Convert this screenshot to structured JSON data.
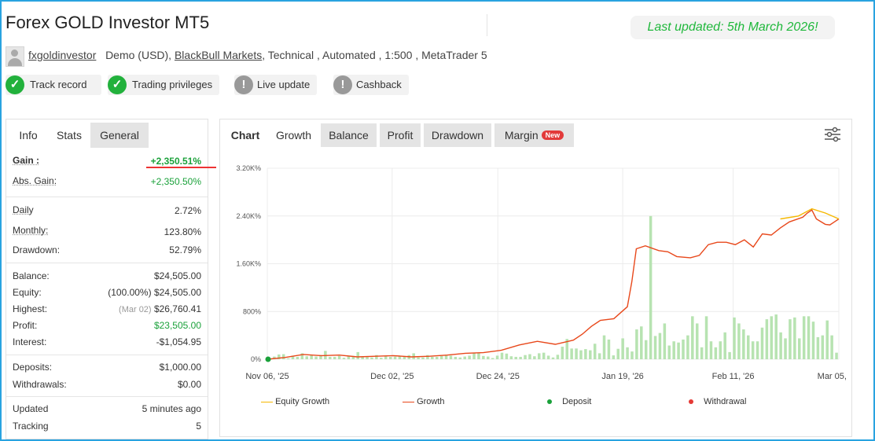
{
  "header": {
    "title": "Forex GOLD Investor MT5",
    "last_updated": "Last updated: 5th March 2026!"
  },
  "account": {
    "username": "fxgoldinvestor",
    "account_type": "Demo (USD),",
    "broker": "BlackBull Markets",
    "details": ", Technical , Automated , 1:500 , MetaTrader 5"
  },
  "badges": [
    {
      "label": "Track record",
      "icon": "check-icon"
    },
    {
      "label": "Trading privileges",
      "icon": "check-icon"
    },
    {
      "label": "Live update",
      "icon": "exclamation-icon"
    },
    {
      "label": "Cashback",
      "icon": "exclamation-icon"
    }
  ],
  "left_tabs": [
    "Info",
    "Stats",
    "General"
  ],
  "stats": {
    "gain": {
      "label": "Gain :",
      "value": "+2,350.51%"
    },
    "abs_gain": {
      "label": "Abs. Gain:",
      "value": "+2,350.50%"
    },
    "daily": {
      "label": "Daily",
      "value": "2.72%"
    },
    "monthly": {
      "label": "Monthly:",
      "value": "123.80%"
    },
    "drawdown": {
      "label": "Drawdown:",
      "value": "52.79%"
    },
    "balance": {
      "label": "Balance:",
      "value": "$24,505.00"
    },
    "equity": {
      "label": "Equity:",
      "pct": "(100.00%)",
      "value": "$24,505.00"
    },
    "highest": {
      "label": "Highest:",
      "date": "(Mar 02)",
      "value": "$26,760.41"
    },
    "profit": {
      "label": "Profit:",
      "value": "$23,505.00"
    },
    "interest": {
      "label": "Interest:",
      "value": "-$1,054.95"
    },
    "deposits": {
      "label": "Deposits:",
      "value": "$1,000.00"
    },
    "withdrawals": {
      "label": "Withdrawals:",
      "value": "$0.00"
    },
    "updated": {
      "label": "Updated",
      "value": "5 minutes ago"
    },
    "tracking": {
      "label": "Tracking",
      "value": "5"
    }
  },
  "chart_tabs": {
    "chart": "Chart",
    "growth": "Growth",
    "balance": "Balance",
    "profit": "Profit",
    "drawdown": "Drawdown",
    "margin": "Margin",
    "new_badge": "New"
  },
  "colors": {
    "accent_green": "#1fb83b",
    "frame_blue": "#29a3e0",
    "equity_line": "#f5b800",
    "growth_line": "#e8481b",
    "deposit": "#1aa13a",
    "withdrawal": "#e53935",
    "bars": "#b7e3b1"
  },
  "chart_data": {
    "type": "line",
    "y_ticks": [
      "0%",
      "800%",
      "1.60K%",
      "2.40K%",
      "3.20K%"
    ],
    "ylim": [
      0,
      3200
    ],
    "x_ticks": [
      "Nov 06, '25",
      "Dec 02, '25",
      "Dec 24, '25",
      "Jan 19, '26",
      "Feb 11, '26",
      "Mar 05, '26"
    ],
    "x_tick_days": [
      0,
      26,
      48,
      74,
      97,
      119
    ],
    "xlim": [
      0,
      119
    ],
    "grid": true,
    "legend_position": "bottom",
    "series": [
      {
        "name": "Equity Growth",
        "points": [
          [
            106,
            2350
          ],
          [
            110,
            2400
          ],
          [
            113,
            2520
          ],
          [
            116,
            2450
          ],
          [
            119,
            2350
          ]
        ]
      },
      {
        "name": "Growth",
        "points": [
          [
            0,
            0
          ],
          [
            4,
            30
          ],
          [
            8,
            80
          ],
          [
            12,
            60
          ],
          [
            16,
            70
          ],
          [
            20,
            40
          ],
          [
            24,
            50
          ],
          [
            28,
            60
          ],
          [
            32,
            40
          ],
          [
            36,
            50
          ],
          [
            40,
            70
          ],
          [
            44,
            100
          ],
          [
            48,
            110
          ],
          [
            52,
            150
          ],
          [
            56,
            240
          ],
          [
            60,
            300
          ],
          [
            64,
            250
          ],
          [
            68,
            320
          ],
          [
            70,
            420
          ],
          [
            72,
            550
          ],
          [
            74,
            650
          ],
          [
            77,
            680
          ],
          [
            80,
            880
          ],
          [
            81,
            1300
          ],
          [
            82,
            1850
          ],
          [
            84,
            1900
          ],
          [
            87,
            1820
          ],
          [
            89,
            1800
          ],
          [
            91,
            1720
          ],
          [
            94,
            1700
          ],
          [
            96,
            1740
          ],
          [
            98,
            1920
          ],
          [
            100,
            1960
          ],
          [
            102,
            1960
          ],
          [
            104,
            1920
          ],
          [
            106,
            2000
          ],
          [
            108,
            1880
          ],
          [
            110,
            2100
          ],
          [
            112,
            2080
          ],
          [
            114,
            2200
          ],
          [
            116,
            2300
          ],
          [
            119,
            2380
          ],
          [
            120,
            2450
          ],
          [
            121,
            2500
          ],
          [
            122,
            2350
          ],
          [
            124,
            2260
          ],
          [
            125,
            2250
          ],
          [
            126,
            2300
          ],
          [
            127,
            2350
          ]
        ]
      },
      {
        "name": "Deposit",
        "points": [
          [
            0,
            0
          ]
        ]
      },
      {
        "name": "Withdrawal",
        "points": []
      }
    ],
    "bars": [
      0,
      45,
      80,
      85,
      15,
      60,
      40,
      100,
      50,
      70,
      45,
      70,
      140,
      40,
      40,
      55,
      25,
      55,
      55,
      120,
      35,
      40,
      30,
      70,
      25,
      50,
      40,
      45,
      55,
      40,
      70,
      100,
      30,
      30,
      70,
      40,
      40,
      55,
      70,
      60,
      40,
      30,
      45,
      60,
      100,
      110,
      55,
      45,
      20,
      60,
      110,
      95,
      50,
      40,
      40,
      70,
      85,
      50,
      100,
      110,
      60,
      30,
      75,
      210,
      340,
      180,
      180,
      150,
      170,
      150,
      260,
      100,
      400,
      330,
      65,
      175,
      350,
      200,
      130,
      500,
      550,
      320,
      2400,
      390,
      440,
      600,
      230,
      300,
      280,
      330,
      400,
      720,
      600,
      200,
      720,
      300,
      200,
      300,
      450,
      120,
      700,
      600,
      500,
      400,
      300,
      300,
      530,
      670,
      720,
      750,
      450,
      350,
      670,
      700,
      350,
      720,
      720,
      630,
      370,
      400,
      650,
      400,
      110
    ]
  }
}
